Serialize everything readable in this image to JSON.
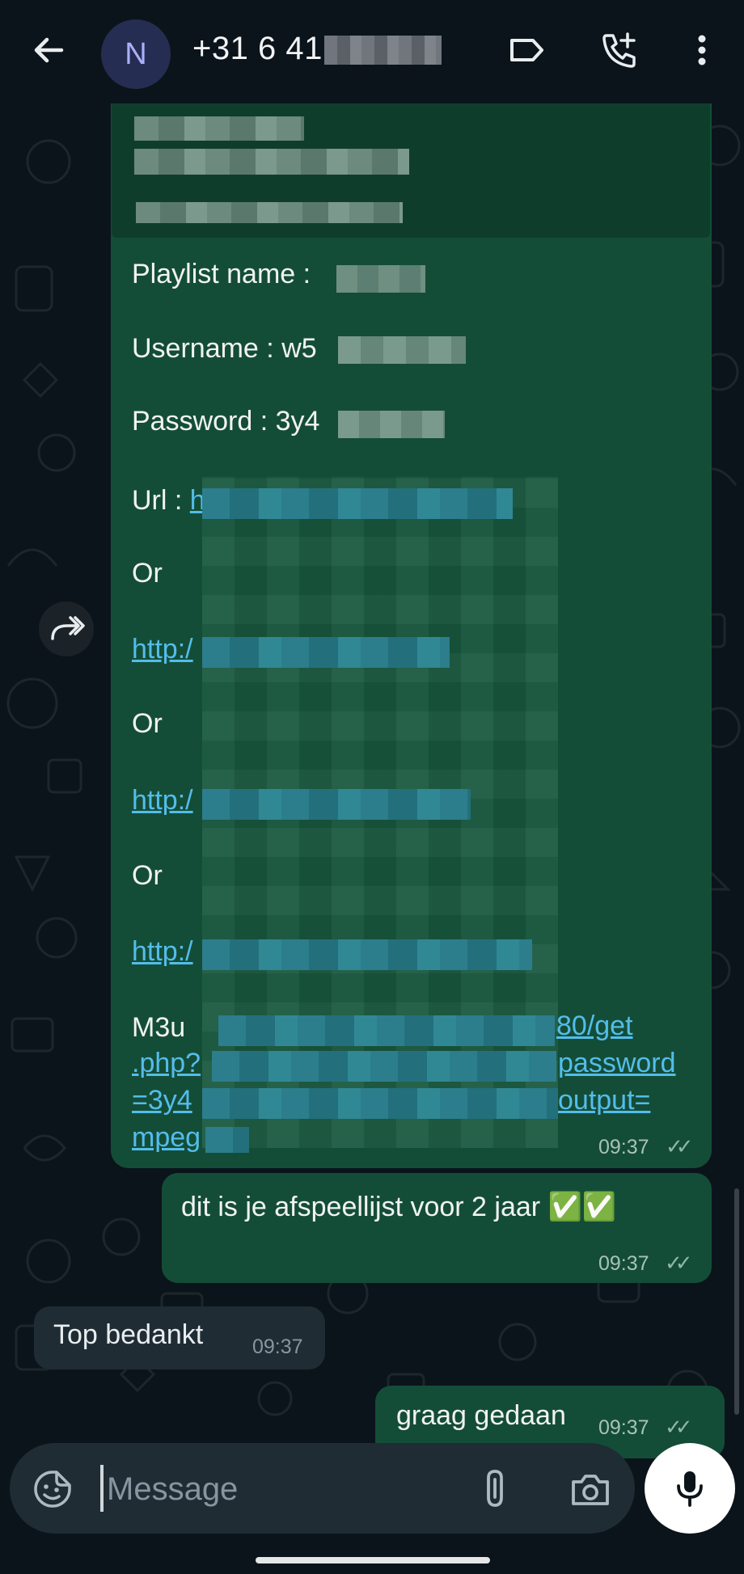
{
  "header": {
    "avatar_letter": "N",
    "contact_number": "+31 6 41"
  },
  "icons": {
    "back": "arrow-left-icon",
    "label": "label-tag-icon",
    "call": "add-call-icon",
    "menu": "more-vertical-icon",
    "forward": "forward-icon",
    "emoji": "sticker-icon",
    "attach": "paperclip-icon",
    "camera": "camera-icon",
    "mic": "microphone-icon"
  },
  "colors": {
    "outgoing_bubble": "#144d37",
    "incoming_bubble": "#1f2c34",
    "link": "#53bdeb",
    "background": "#0b141a"
  },
  "messages": {
    "long": {
      "playlist_label": "Playlist name :",
      "username_label": "Username :",
      "username_partial": "w5",
      "password_label": "Password :",
      "password_partial": "3y4",
      "url_label": "Url :",
      "url_partial": "h",
      "or_1": "Or",
      "link_1": "http:/",
      "or_2": "Or",
      "link_2": "http:/",
      "or_3": "Or",
      "link_3": "http:/",
      "m3u_label": "M3u",
      "m3u_tail_1": "80/get",
      "m3u_line_2": ".php?",
      "m3u_line_2_tail": "password",
      "m3u_line_3": "=3y4",
      "m3u_line_3_tail": "output=",
      "m3u_line_4": "mpeg",
      "time": "09:37",
      "status": "✓✓"
    },
    "afspeellijst": {
      "text": "dit is je afspeellijst voor 2 jaar ✅✅",
      "time": "09:37",
      "status": "✓✓"
    },
    "bedankt": {
      "text": "Top bedankt",
      "time": "09:37"
    },
    "gedaan": {
      "text": "graag gedaan",
      "time": "09:37",
      "status": "✓✓"
    }
  },
  "composer": {
    "placeholder": "Message"
  }
}
